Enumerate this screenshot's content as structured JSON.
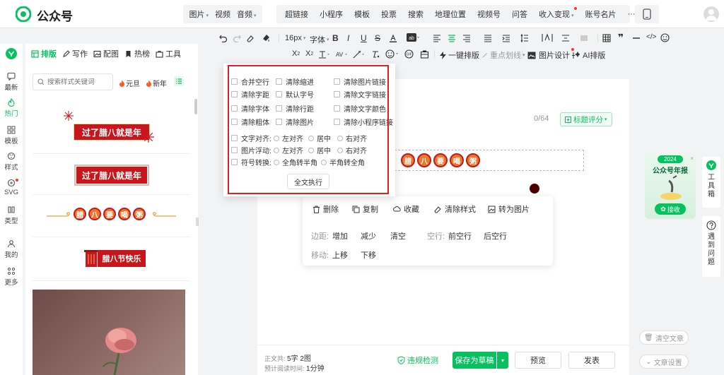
{
  "brand": {
    "name": "公众号"
  },
  "top_insert": {
    "group1": [
      "图片",
      "视频",
      "音频"
    ],
    "group2": [
      "超链接",
      "小程序",
      "模板",
      "投票",
      "搜索",
      "地理位置",
      "视频号",
      "问答",
      "收入变现",
      "账号名片"
    ],
    "more": "···"
  },
  "left_rail": [
    {
      "label": "最新",
      "icon": "chat-icon"
    },
    {
      "label": "热门",
      "icon": "flame-icon",
      "active": true
    },
    {
      "label": "模板",
      "icon": "grid-icon"
    },
    {
      "label": "样式",
      "icon": "palette-icon"
    },
    {
      "label": "SVG",
      "icon": "svg-icon",
      "badge": true
    },
    {
      "label": "类型",
      "icon": "book-icon"
    },
    {
      "label": "我的",
      "icon": "user-icon"
    },
    {
      "label": "更多",
      "icon": "apps-icon"
    }
  ],
  "panel_tabs": [
    {
      "label": "排版",
      "icon": "layout-icon",
      "active": true
    },
    {
      "label": "写作",
      "icon": "pen-icon"
    },
    {
      "label": "配图",
      "icon": "image-icon"
    },
    {
      "label": "热榜",
      "icon": "bookmark-icon"
    },
    {
      "label": "工具",
      "icon": "toolbox-icon"
    }
  ],
  "search": {
    "placeholder": "搜索样式关键词"
  },
  "hot_tags": [
    "元旦",
    "新年"
  ],
  "templates": {
    "t1": "过了腊八就是年",
    "t2": "过了腊八就是年",
    "t3": [
      "腊",
      "八",
      "要",
      "喝",
      "粥"
    ],
    "t4": "腊八节快乐"
  },
  "format_bar": {
    "font_size": "16px",
    "font_family": "字体",
    "bold": "B",
    "italic": "I",
    "underline": "U",
    "strike": "S",
    "one_click": "一键排版",
    "highlight": "重点划线",
    "image_design": "图片设计",
    "ai": "AI排版"
  },
  "editor": {
    "title_count": "0/64",
    "title_score": "标题评分",
    "block_chars": [
      "腊",
      "八",
      "要",
      "喝",
      "粥"
    ],
    "swatch_color": "#4a0000"
  },
  "context_panel": {
    "actions": [
      "删除",
      "复制",
      "收藏",
      "清除样式",
      "转为图片"
    ],
    "margin_label": "边距:",
    "margin_opts": [
      "增加",
      "减少",
      "清空"
    ],
    "blank_label": "空行:",
    "blank_opts": [
      "前空行",
      "后空行"
    ],
    "move_label": "移动:",
    "move_opts": [
      "上移",
      "下移"
    ]
  },
  "dropdown": {
    "checks": [
      [
        "合并空行",
        "清除缩进",
        "清除图片链接"
      ],
      [
        "清除字距",
        "默认字号",
        "清除文字链接"
      ],
      [
        "清除字体",
        "清除行距",
        "清除文字颜色"
      ],
      [
        "清除粗体",
        "清除图片",
        "清除小程序链接"
      ]
    ],
    "align_label": "文字对齐:",
    "align_opts": [
      "左对齐",
      "居中",
      "右对齐"
    ],
    "float_label": "图片浮动:",
    "float_opts": [
      "左对齐",
      "居中",
      "右对齐"
    ],
    "symbol_label": "符号转换:",
    "symbol_opts": [
      "全角转半角",
      "半角转全角"
    ],
    "run_all": "全文执行"
  },
  "bottom": {
    "body_label": "正文共:",
    "body_value": "5字 2图",
    "read_label": "预计阅读时间:",
    "read_value": "1分钟",
    "check": "违规检测",
    "save_draft": "保存为草稿",
    "preview": "预览",
    "publish": "发表"
  },
  "right_side": {
    "promo_year": "2024",
    "promo_title": "公众号年报",
    "promo_btn": "接收",
    "toolbox": "工具箱",
    "help": "遇到问题",
    "clear_article": "清空文章",
    "article_settings": "文章设置"
  },
  "colors": {
    "accent": "#07c160",
    "festive_red": "#c8161d",
    "outline_red": "#e02020"
  }
}
